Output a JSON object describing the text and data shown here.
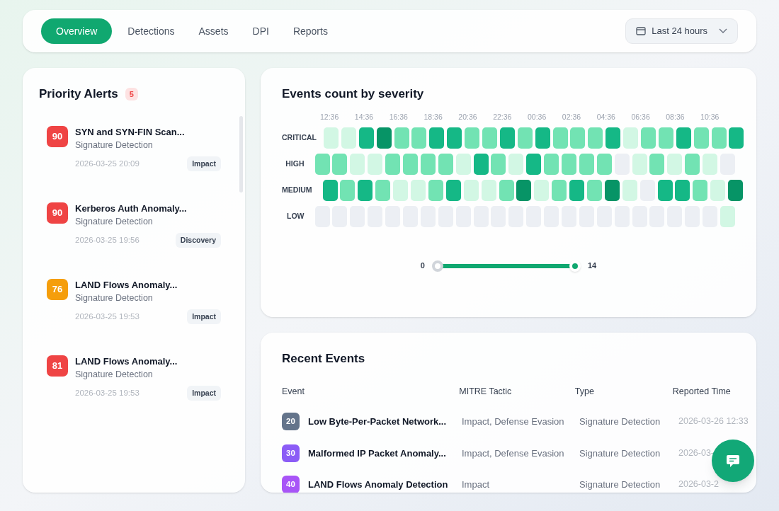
{
  "nav": {
    "tabs": [
      {
        "label": "Overview",
        "selected": true
      },
      {
        "label": "Detections",
        "selected": false
      },
      {
        "label": "Assets",
        "selected": false
      },
      {
        "label": "DPI",
        "selected": false
      },
      {
        "label": "Reports",
        "selected": false
      }
    ],
    "range": "Last 24 hours"
  },
  "alerts": {
    "title": "Priority Alerts",
    "count": "5",
    "items": [
      {
        "score": "90",
        "color": "#ef4444",
        "name": "SYN and SYN-FIN Scan...",
        "source": "Signature Detection",
        "time": "2026-03-25 20:09",
        "tag": "Impact"
      },
      {
        "score": "90",
        "color": "#ef4444",
        "name": "Kerberos Auth Anomaly...",
        "source": "Signature Detection",
        "time": "2026-03-25 19:56",
        "tag": "Discovery"
      },
      {
        "score": "76",
        "color": "#f59e0b",
        "name": "LAND Flows Anomaly...",
        "source": "Signature Detection",
        "time": "2026-03-25 19:53",
        "tag": "Impact"
      },
      {
        "score": "81",
        "color": "#ef4444",
        "name": "LAND Flows Anomaly...",
        "source": "Signature Detection",
        "time": "2026-03-25 19:53",
        "tag": "Impact"
      }
    ]
  },
  "heatmap": {
    "title": "Events count by severity",
    "times": [
      "12:36",
      "14:36",
      "16:36",
      "18:36",
      "20:36",
      "22:36",
      "00:36",
      "02:36",
      "04:36",
      "06:36",
      "08:36",
      "10:36"
    ],
    "rows": [
      {
        "label": "CRITICAL",
        "cells": [
          {
            "color": "#d2f7e4"
          },
          {
            "color": "#d2f7e4"
          },
          {
            "color": "#15b886"
          },
          {
            "color": "#079466"
          },
          {
            "color": "#72e3b3"
          },
          {
            "color": "#72e3b3"
          },
          {
            "color": "#15b886"
          },
          {
            "color": "#15b886"
          },
          {
            "color": "#72e3b3"
          },
          {
            "color": "#72e3b3"
          },
          {
            "color": "#15b886"
          },
          {
            "color": "#72e3b3"
          },
          {
            "color": "#15b886"
          },
          {
            "color": "#72e3b3"
          },
          {
            "color": "#72e3b3"
          },
          {
            "color": "#72e3b3"
          },
          {
            "color": "#15b886"
          },
          {
            "color": "#d2f7e4"
          },
          {
            "color": "#72e3b3"
          },
          {
            "color": "#72e3b3"
          },
          {
            "color": "#15b886"
          },
          {
            "color": "#72e3b3"
          },
          {
            "color": "#72e3b3"
          },
          {
            "color": "#15b886"
          }
        ]
      },
      {
        "label": "HIGH",
        "cells": [
          {
            "color": "#72e3b3"
          },
          {
            "color": "#72e3b3"
          },
          {
            "color": "#d2f7e4"
          },
          {
            "color": "#d2f7e4"
          },
          {
            "color": "#72e3b3"
          },
          {
            "color": "#72e3b3"
          },
          {
            "color": "#72e3b3"
          },
          {
            "color": "#72e3b3"
          },
          {
            "color": "#d2f7e4"
          },
          {
            "color": "#15b886"
          },
          {
            "color": "#72e3b3"
          },
          {
            "color": "#d2f7e4"
          },
          {
            "color": "#15b886"
          },
          {
            "color": "#72e3b3"
          },
          {
            "color": "#72e3b3"
          },
          {
            "color": "#72e3b3"
          },
          {
            "color": "#72e3b3"
          },
          {
            "color": "#eceff4"
          },
          {
            "color": "#d2f7e4"
          },
          {
            "color": "#72e3b3"
          },
          {
            "color": "#d2f7e4"
          },
          {
            "color": "#72e3b3"
          },
          {
            "color": "#d2f7e4"
          },
          {
            "color": "#eceff4"
          }
        ]
      },
      {
        "label": "MEDIUM",
        "cells": [
          {
            "color": "#15b886"
          },
          {
            "color": "#72e3b3"
          },
          {
            "color": "#15b886"
          },
          {
            "color": "#72e3b3"
          },
          {
            "color": "#d2f7e4"
          },
          {
            "color": "#d2f7e4"
          },
          {
            "color": "#72e3b3"
          },
          {
            "color": "#15b886"
          },
          {
            "color": "#d2f7e4"
          },
          {
            "color": "#d2f7e4"
          },
          {
            "color": "#72e3b3"
          },
          {
            "color": "#079466"
          },
          {
            "color": "#d2f7e4"
          },
          {
            "color": "#72e3b3"
          },
          {
            "color": "#15b886"
          },
          {
            "color": "#72e3b3"
          },
          {
            "color": "#079466"
          },
          {
            "color": "#d2f7e4"
          },
          {
            "color": "#eceff4"
          },
          {
            "color": "#15b886"
          },
          {
            "color": "#15b886"
          },
          {
            "color": "#72e3b3"
          },
          {
            "color": "#d2f7e4"
          },
          {
            "color": "#079466"
          }
        ]
      },
      {
        "label": "LOW",
        "cells": [
          {
            "color": "#eceff4"
          },
          {
            "color": "#eceff4"
          },
          {
            "color": "#eceff4"
          },
          {
            "color": "#eceff4"
          },
          {
            "color": "#eceff4"
          },
          {
            "color": "#eceff4"
          },
          {
            "color": "#eceff4"
          },
          {
            "color": "#eceff4"
          },
          {
            "color": "#eceff4"
          },
          {
            "color": "#eceff4"
          },
          {
            "color": "#eceff4"
          },
          {
            "color": "#eceff4"
          },
          {
            "color": "#eceff4"
          },
          {
            "color": "#eceff4"
          },
          {
            "color": "#eceff4"
          },
          {
            "color": "#eceff4"
          },
          {
            "color": "#eceff4"
          },
          {
            "color": "#eceff4"
          },
          {
            "color": "#eceff4"
          },
          {
            "color": "#eceff4"
          },
          {
            "color": "#eceff4"
          },
          {
            "color": "#eceff4"
          },
          {
            "color": "#eceff4"
          },
          {
            "color": "#d2f7e4"
          }
        ]
      }
    ],
    "scale": {
      "min": "0",
      "max": "14",
      "level": 1
    }
  },
  "events": {
    "title": "Recent Events",
    "columns": [
      "Event",
      "MITRE Tactic",
      "Type",
      "Reported Time"
    ],
    "rows": [
      {
        "score": "20",
        "color": "#64748b",
        "name": "Low Byte-Per-Packet Network...",
        "tactic": "Impact, Defense Evasion",
        "type": "Signature Detection",
        "time": "2026-03-26 12:33"
      },
      {
        "score": "30",
        "color": "#8b5cf6",
        "name": "Malformed IP Packet Anomaly...",
        "tactic": "Impact, Defense Evasion",
        "type": "Signature Detection",
        "time": "2026-03-"
      },
      {
        "score": "40",
        "color": "#a855f7",
        "name": "LAND Flows Anomaly Detection",
        "tactic": "Impact",
        "type": "Signature Detection",
        "time": "2026-03-2"
      }
    ]
  }
}
